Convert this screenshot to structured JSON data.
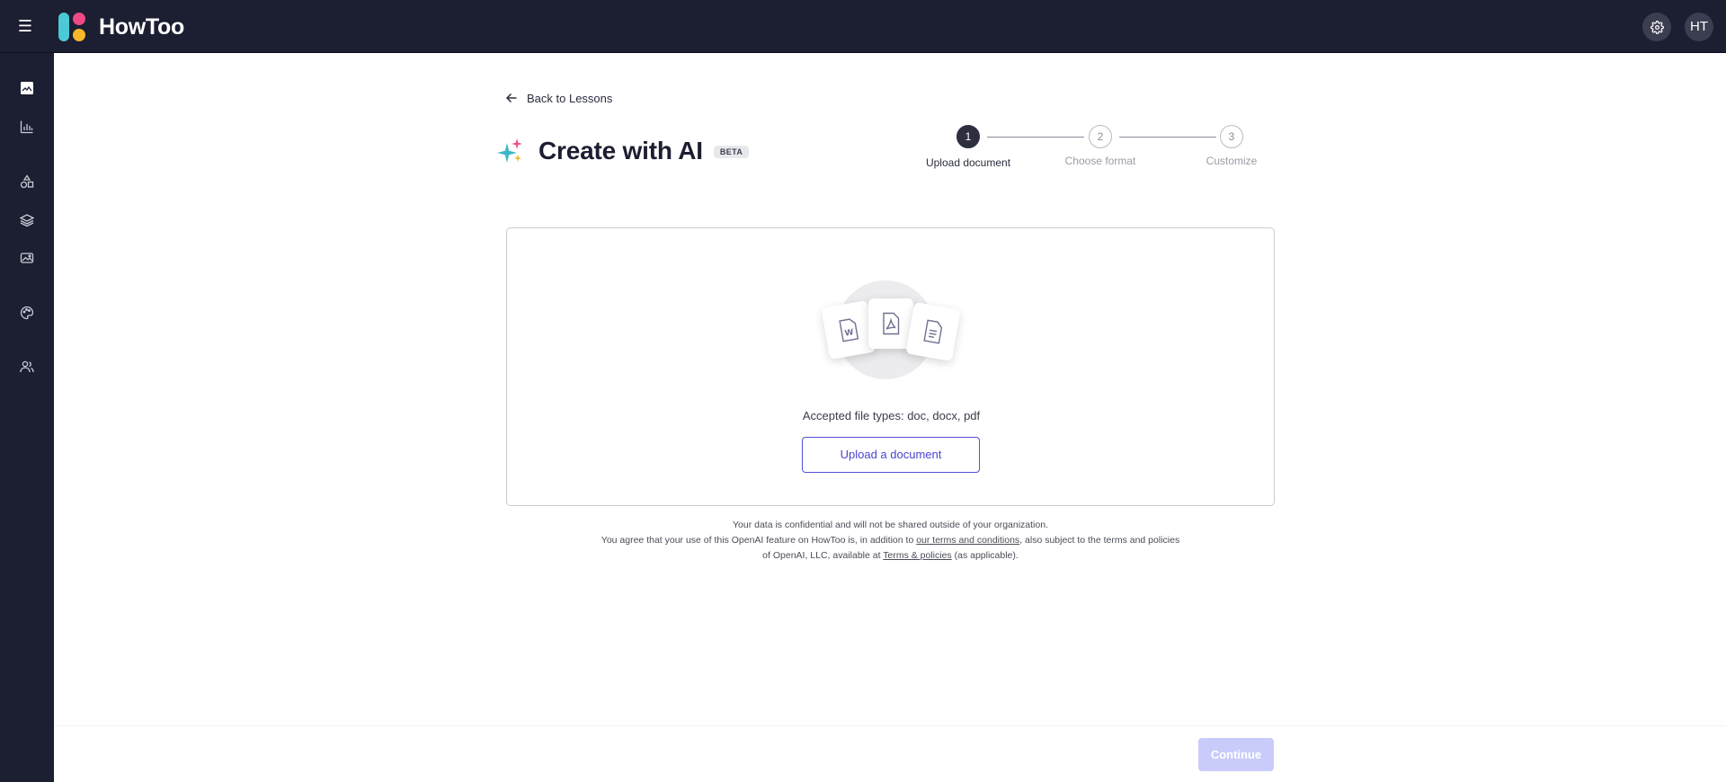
{
  "app": {
    "name": "HowToo",
    "logo_text": "HowToo"
  },
  "topbar": {
    "menu_icon": "hamburger-menu-icon",
    "settings_icon": "gear-icon",
    "avatar_initials": "HT"
  },
  "sidebar": {
    "items": [
      {
        "icon": "lessons-icon"
      },
      {
        "icon": "analytics-icon"
      },
      {
        "icon": "shapes-icon"
      },
      {
        "icon": "layers-icon"
      },
      {
        "icon": "media-icon"
      },
      {
        "icon": "palette-icon"
      },
      {
        "icon": "users-icon"
      }
    ]
  },
  "page": {
    "back_label": "Back to Lessons",
    "title": "Create with AI",
    "badge": "BETA"
  },
  "stepper": {
    "steps": [
      {
        "number": "1",
        "label": "Upload document",
        "state": "active"
      },
      {
        "number": "2",
        "label": "Choose format",
        "state": "inactive"
      },
      {
        "number": "3",
        "label": "Customize",
        "state": "inactive"
      }
    ]
  },
  "upload": {
    "accepted_types": "Accepted file types: doc, docx, pdf",
    "button_label": "Upload a document"
  },
  "disclaimer": {
    "line1": "Your data is confidential and will not be shared outside of your organization.",
    "line2_prefix": "You agree that your use of this OpenAI feature on HowToo is, in addition to ",
    "terms_link": "our terms and conditions",
    "line2_suffix": ", also subject to the terms and policies",
    "line3_prefix": "of OpenAI, LLC, available at ",
    "policies_link": "Terms & policies",
    "line3_suffix": " (as applicable)."
  },
  "footer": {
    "continue_label": "Continue"
  },
  "colors": {
    "nav_bg": "#1c1e31",
    "accent": "#4a45d0",
    "continue_disabled": "#c9ccfa",
    "logo_teal": "#4cc9d6",
    "logo_pink": "#ef4a86",
    "logo_yellow": "#f6b82a"
  }
}
